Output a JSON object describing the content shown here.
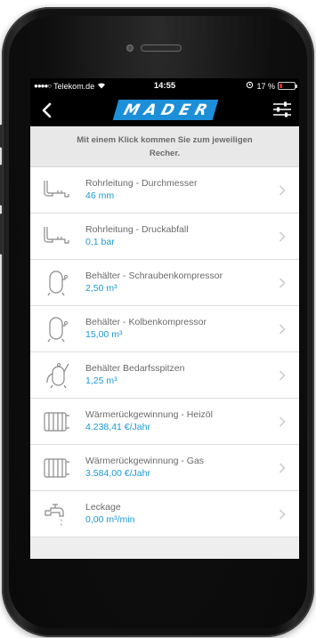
{
  "status_bar": {
    "carrier": "Telekom.de",
    "time": "14:55",
    "battery_percent": "17 %",
    "battery_level": 0.17
  },
  "nav": {
    "logo": "MADER"
  },
  "hint": {
    "line1": "Mit einem Klick kommen Sie zum jeweiligen",
    "line2": "Recher."
  },
  "items": [
    {
      "title": "Rohrleitung - Durchmesser",
      "value": "46 mm",
      "icon": "pipe-icon"
    },
    {
      "title": "Rohrleitung - Druckabfall",
      "value": "0,1 bar",
      "icon": "pipe-icon"
    },
    {
      "title": "Behälter - Schraubenkompressor",
      "value": "2,50 m³",
      "icon": "tank-icon"
    },
    {
      "title": "Behälter - Kolbenkompressor",
      "value": "15,00 m³",
      "icon": "tank-icon"
    },
    {
      "title": "Behälter Bedarfsspitzen",
      "value": "1,25 m³",
      "icon": "tank-peak-icon"
    },
    {
      "title": "Wärmerückgewinnung - Heizöl",
      "value": "4.238,41 €/Jahr",
      "icon": "radiator-icon"
    },
    {
      "title": "Wärmerückgewinnung - Gas",
      "value": "3.584,00 €/Jahr",
      "icon": "radiator-icon"
    },
    {
      "title": "Leckage",
      "value": "0,00 m³/min",
      "icon": "faucet-icon"
    }
  ],
  "colors": {
    "accent": "#1c98d6",
    "logo_bg": "#1c8fd8",
    "battery_low": "#e22222"
  }
}
